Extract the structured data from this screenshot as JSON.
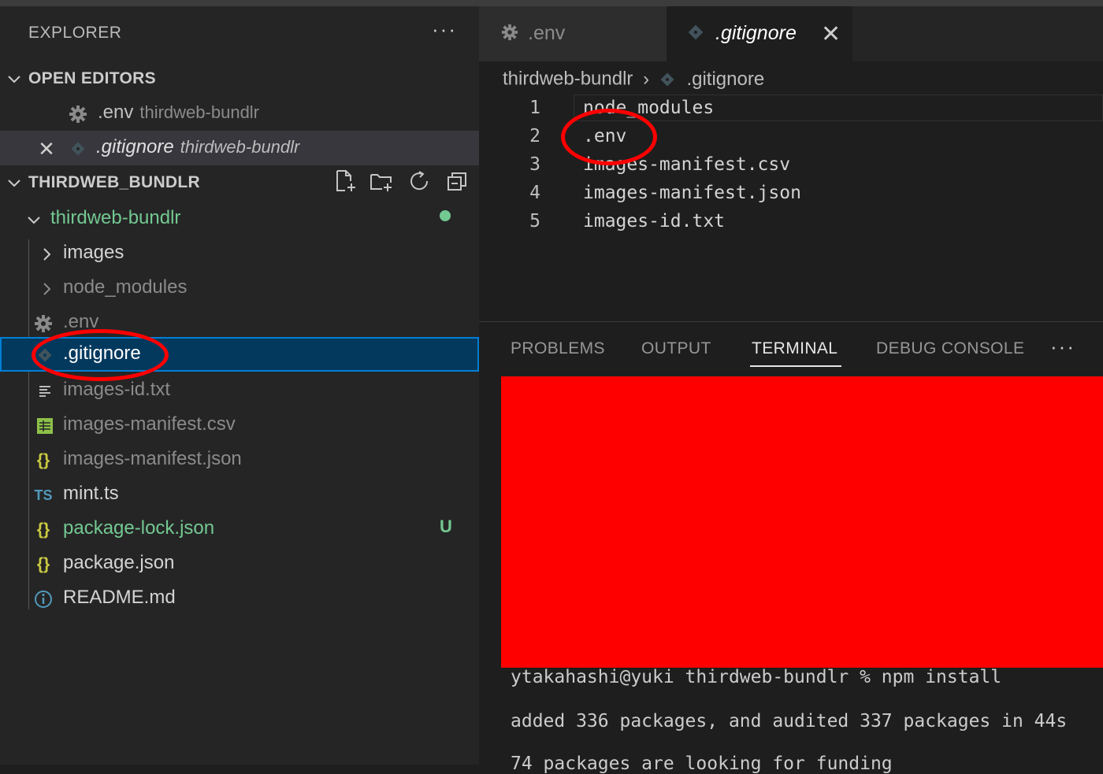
{
  "explorer": {
    "title": "EXPLORER",
    "more": "···",
    "open_editors": {
      "label": "OPEN EDITORS",
      "items": [
        {
          "name": ".env",
          "desc": "thirdweb-bundlr"
        },
        {
          "name": ".gitignore",
          "desc": "thirdweb-bundlr",
          "close": "✕"
        }
      ]
    },
    "workspace": {
      "label": "THIRDWEB_BUNDLR",
      "root": "thirdweb-bundlr",
      "items": [
        {
          "name": "images",
          "kind": "folder"
        },
        {
          "name": "node_modules",
          "kind": "folder"
        },
        {
          "name": ".env",
          "kind": "gear"
        },
        {
          "name": ".gitignore",
          "kind": "git"
        },
        {
          "name": "images-id.txt",
          "kind": "txt"
        },
        {
          "name": "images-manifest.csv",
          "kind": "csv"
        },
        {
          "name": "images-manifest.json",
          "kind": "json"
        },
        {
          "name": "mint.ts",
          "kind": "ts",
          "icon_text": "TS"
        },
        {
          "name": "package-lock.json",
          "kind": "json",
          "badge": "U"
        },
        {
          "name": "package.json",
          "kind": "json"
        },
        {
          "name": "README.md",
          "kind": "info"
        }
      ]
    }
  },
  "editor": {
    "tabs": [
      {
        "label": ".env"
      },
      {
        "label": ".gitignore",
        "close": "✕"
      }
    ],
    "breadcrumb": {
      "folder": "thirdweb-bundlr",
      "sep": "›",
      "file": ".gitignore"
    },
    "lines": [
      {
        "n": "1",
        "text": "node_modules"
      },
      {
        "n": "2",
        "text": ".env"
      },
      {
        "n": "3",
        "text": "images-manifest.csv"
      },
      {
        "n": "4",
        "text": "images-manifest.json"
      },
      {
        "n": "5",
        "text": "images-id.txt"
      }
    ]
  },
  "panel": {
    "tabs": [
      "PROBLEMS",
      "OUTPUT",
      "TERMINAL",
      "DEBUG CONSOLE"
    ],
    "more": "···",
    "terminal": [
      "ytakahashi@yuki thirdweb-bundlr % npm install",
      "added 336 packages, and audited 337 packages in 44s",
      "74 packages are looking for funding"
    ]
  },
  "colors": {
    "accent_blue": "#007fd4",
    "git_untracked": "#73c991",
    "annotation_red": "#ff0000"
  }
}
